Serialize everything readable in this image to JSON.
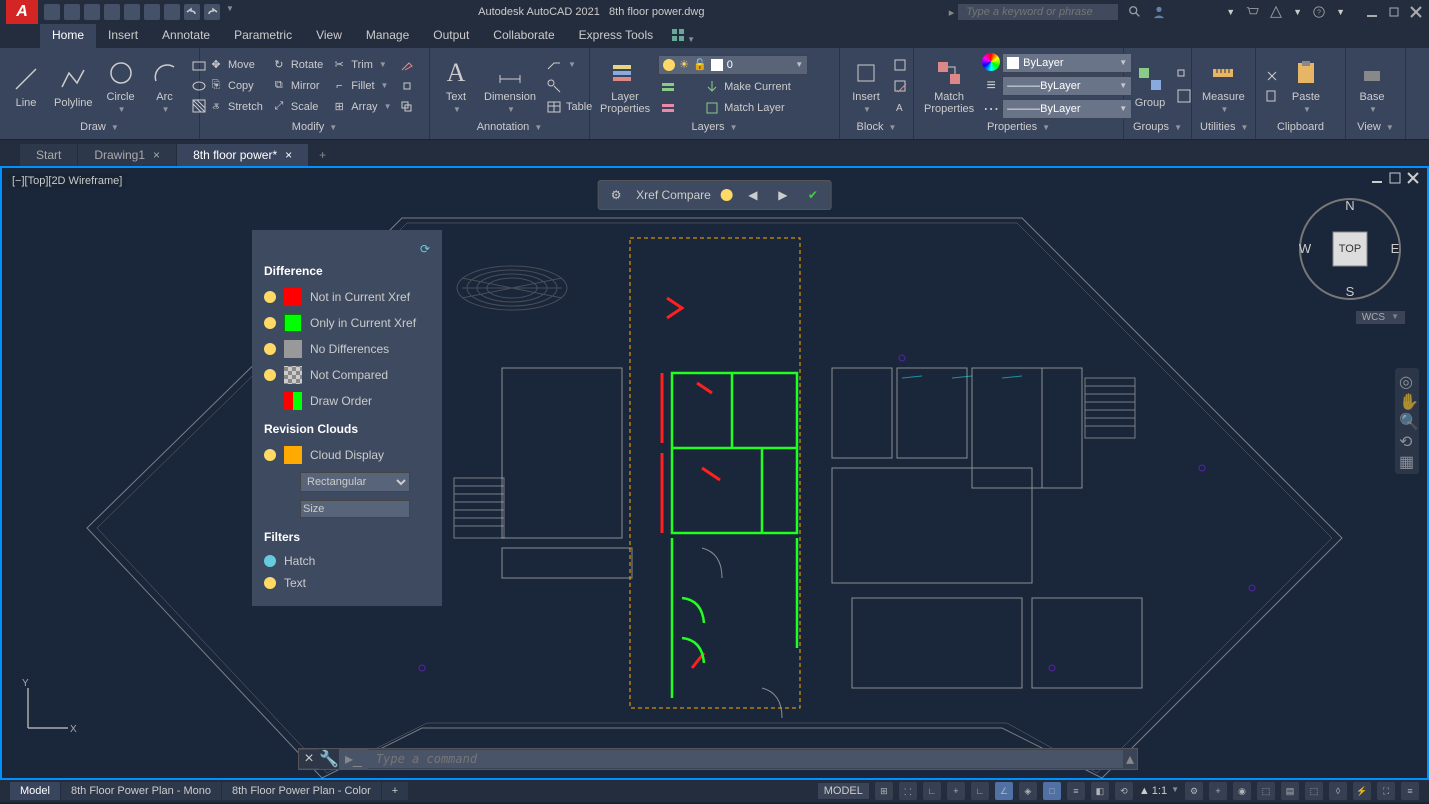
{
  "app": {
    "name": "Autodesk AutoCAD 2021",
    "file": "8th floor power.dwg"
  },
  "search": {
    "placeholder": "Type a keyword or phrase"
  },
  "menu": [
    "Home",
    "Insert",
    "Annotate",
    "Parametric",
    "View",
    "Manage",
    "Output",
    "Collaborate",
    "Express Tools"
  ],
  "menu_active": 0,
  "ribbon": {
    "draw": {
      "label": "Draw",
      "tools": [
        "Line",
        "Polyline",
        "Circle",
        "Arc"
      ]
    },
    "modify": {
      "label": "Modify",
      "move": "Move",
      "rotate": "Rotate",
      "trim": "Trim",
      "copy": "Copy",
      "mirror": "Mirror",
      "fillet": "Fillet",
      "stretch": "Stretch",
      "scale": "Scale",
      "array": "Array"
    },
    "annotation": {
      "label": "Annotation",
      "text": "Text",
      "dim": "Dimension",
      "table": "Table"
    },
    "layers": {
      "label": "Layers",
      "props": "Layer\nProperties",
      "make": "Make Current",
      "match": "Match Layer",
      "current": "0"
    },
    "block": {
      "label": "Block",
      "insert": "Insert"
    },
    "properties": {
      "label": "Properties",
      "match": "Match\nProperties",
      "bylayer": "ByLayer"
    },
    "groups": {
      "label": "Groups",
      "group": "Group"
    },
    "utils": {
      "label": "Utilities",
      "measure": "Measure"
    },
    "clipboard": {
      "label": "Clipboard",
      "paste": "Paste"
    },
    "view": {
      "label": "View",
      "base": "Base"
    }
  },
  "file_tabs": [
    "Start",
    "Drawing1",
    "8th floor power*"
  ],
  "file_tab_active": 2,
  "view_label": "[−][Top][2D Wireframe]",
  "xref": {
    "title": "Xref Compare"
  },
  "diff": {
    "title": "Difference",
    "rows": [
      {
        "color": "#ff0000",
        "label": "Not in Current Xref"
      },
      {
        "color": "#00ff00",
        "label": "Only in Current Xref"
      },
      {
        "color": "#999999",
        "label": "No Differences"
      },
      {
        "color": "checker",
        "label": "Not Compared"
      },
      {
        "color": "split",
        "label": "Draw Order"
      }
    ],
    "clouds_title": "Revision Clouds",
    "cloud_display": "Cloud Display",
    "cloud_color": "#ffaa00",
    "shape": "Rectangular",
    "size_label": "Size",
    "filters_title": "Filters",
    "filters": [
      "Hatch",
      "Text"
    ]
  },
  "viewcube": {
    "top": "TOP",
    "n": "N",
    "s": "S",
    "e": "E",
    "w": "W",
    "wcs": "WCS"
  },
  "cmd": {
    "placeholder": "Type a command"
  },
  "layout_tabs": [
    "Model",
    "8th Floor Power Plan - Mono",
    "8th Floor Power Plan - Color"
  ],
  "layout_active": 0,
  "status": {
    "model": "MODEL",
    "scale": "1:1"
  }
}
